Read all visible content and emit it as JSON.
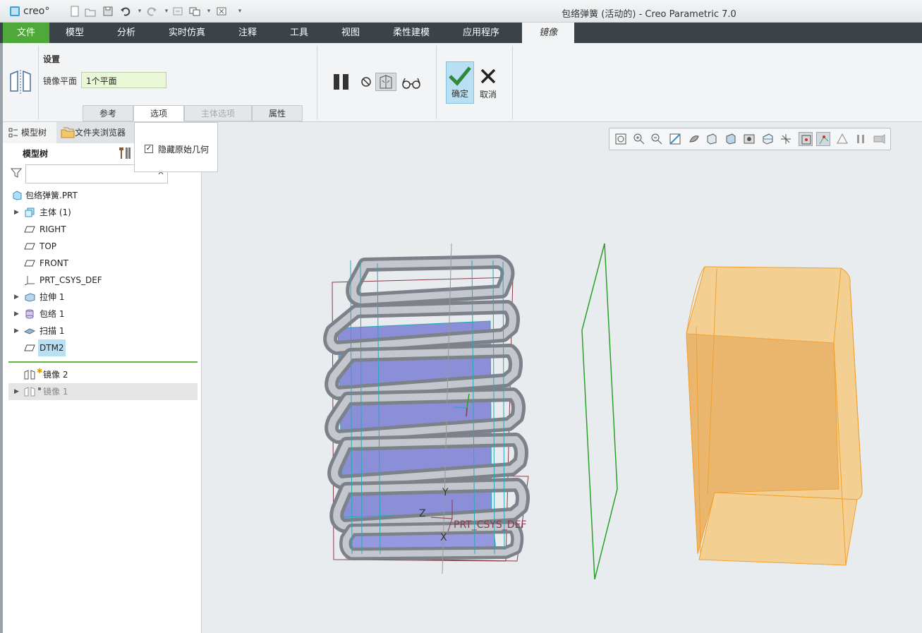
{
  "app": {
    "logo_text": "creo°",
    "window_title": "包络弹簧 (活动的) - Creo Parametric 7.0"
  },
  "menu": {
    "items": [
      "文件",
      "模型",
      "分析",
      "实时仿真",
      "注释",
      "工具",
      "视图",
      "柔性建模",
      "应用程序",
      "镜像"
    ],
    "active": "镜像"
  },
  "ribbon": {
    "group_label": "设置",
    "plane_label": "镜像平面",
    "plane_value": "1个平面",
    "subtabs": [
      "参考",
      "选项",
      "主体选项",
      "属性"
    ],
    "active_subtab": "选项",
    "disabled_subtab": "主体选项",
    "ok_label": "确定",
    "cancel_label": "取消"
  },
  "options_popup": {
    "checkbox_label": "隐藏原始几何",
    "checked": true
  },
  "left_panel": {
    "tabs": [
      "模型树",
      "文件夹浏览器"
    ],
    "tree_title": "模型树",
    "filter_placeholder": "",
    "tree": [
      {
        "label": "包络弹簧.PRT",
        "icon": "part-icon",
        "expandable": false,
        "root": true
      },
      {
        "label": "主体 (1)",
        "icon": "body-icon",
        "expandable": true
      },
      {
        "label": "RIGHT",
        "icon": "datum-plane-icon",
        "expandable": false
      },
      {
        "label": "TOP",
        "icon": "datum-plane-icon",
        "expandable": false
      },
      {
        "label": "FRONT",
        "icon": "datum-plane-icon",
        "expandable": false
      },
      {
        "label": "PRT_CSYS_DEF",
        "icon": "csys-icon",
        "expandable": false
      },
      {
        "label": "拉伸 1",
        "icon": "extrude-icon",
        "expandable": true
      },
      {
        "label": "包络 1",
        "icon": "wrap-icon",
        "expandable": true
      },
      {
        "label": "扫描 1",
        "icon": "sweep-icon",
        "expandable": true
      },
      {
        "label": "DTM2",
        "icon": "datum-plane-icon",
        "expandable": false,
        "selected": true
      }
    ],
    "after_insert": [
      {
        "label": "镜像 2",
        "icon": "mirror-icon",
        "expandable": false
      },
      {
        "label": "镜像 1",
        "icon": "mirror-icon",
        "expandable": true,
        "dimmed": true
      }
    ]
  },
  "viewport": {
    "csys_labels": {
      "x": "X",
      "y": "Y",
      "z": "Z",
      "name": "PRT_CSYS_DEF"
    },
    "colors": {
      "spring": "#a5a9b1",
      "inner_body": "#8a8fd8",
      "mirror_plane": "#2aa02a",
      "preview": "#f0b860"
    }
  }
}
